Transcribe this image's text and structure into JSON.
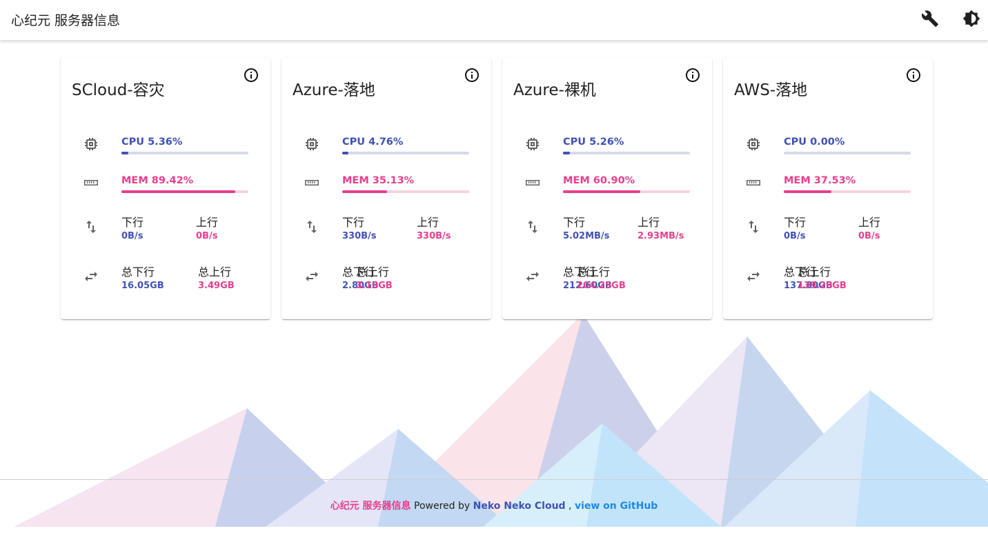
{
  "app": {
    "title": "心纪元 服务器信息"
  },
  "toolbar": [
    {
      "name": "wrench-icon-button"
    },
    {
      "name": "brightness-icon-button"
    }
  ],
  "labels": {
    "down": "下行",
    "up": "上行",
    "total_down": "总下行",
    "total_up": "总上行"
  },
  "colors": {
    "primary": "#3f51b5",
    "accent": "#e83e8c",
    "track_blue": "#d7d9ea",
    "track_pink": "#f6d2e2"
  },
  "servers": [
    {
      "name": "SCloud-容灾",
      "cpu_label": "CPU 5.36%",
      "cpu": 5.36,
      "mem_label": "MEM 89.42%",
      "mem": 89.42,
      "down": "0B/s",
      "up": "0B/s",
      "total_down": "16.05GB",
      "total_up": "3.49GB"
    },
    {
      "name": "Azure-落地",
      "cpu_label": "CPU 4.76%",
      "cpu": 4.76,
      "mem_label": "MEM 35.13%",
      "mem": 35.13,
      "down": "330B/s",
      "up": "330B/s",
      "total_down": "2.80GB",
      "total_up": "3.10GB"
    },
    {
      "name": "Azure-裸机",
      "cpu_label": "CPU 5.26%",
      "cpu": 5.26,
      "mem_label": "MEM 60.90%",
      "mem": 60.9,
      "down": "5.02MB/s",
      "up": "2.93MB/s",
      "total_down": "212.60GB",
      "total_up": "204.25GB"
    },
    {
      "name": "AWS-落地",
      "cpu_label": "CPU 0.00%",
      "cpu": 0.0,
      "mem_label": "MEM 37.53%",
      "mem": 37.53,
      "down": "0B/s",
      "up": "0B/s",
      "total_down": "137.80GB",
      "total_up": "139.20GB"
    }
  ],
  "footer": {
    "brand": "心纪元 服务器信息",
    "powered": " Powered by ",
    "author": "Neko Neko Cloud",
    "sep": " , ",
    "link": "view on GitHub"
  }
}
